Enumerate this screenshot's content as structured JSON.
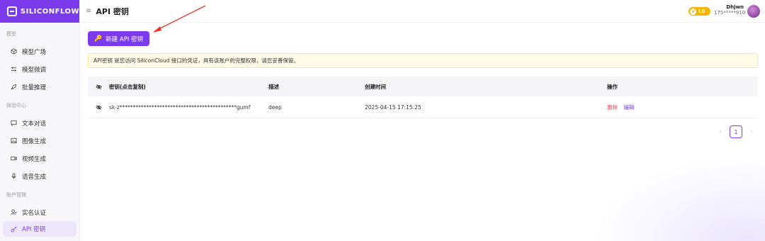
{
  "brand": {
    "name": "SILICONFLOW"
  },
  "sidebar": {
    "sections": [
      {
        "title": "模型",
        "items": [
          {
            "label": "模型广场",
            "icon": "cube-icon"
          },
          {
            "label": "模型微调",
            "icon": "sliders-icon"
          },
          {
            "label": "批量推理",
            "icon": "rocket-icon"
          }
        ]
      },
      {
        "title": "体验中心",
        "items": [
          {
            "label": "文本对话",
            "icon": "chat-icon"
          },
          {
            "label": "图像生成",
            "icon": "image-icon"
          },
          {
            "label": "视频生成",
            "icon": "video-icon"
          },
          {
            "label": "语音生成",
            "icon": "mic-icon"
          }
        ]
      },
      {
        "title": "账户管理",
        "items": [
          {
            "label": "实名认证",
            "icon": "user-check-icon"
          },
          {
            "label": "API 密钥",
            "icon": "key-icon",
            "active": true
          }
        ]
      }
    ]
  },
  "header": {
    "title": "API 密钥",
    "level": "L0",
    "level_icon_text": "V",
    "user_name": "Dhjwn",
    "user_phone": "175*****910"
  },
  "actions": {
    "create_label": "新建 API 密钥"
  },
  "notice": "API密钥 是您访问 SiliconCloud 接口的凭证，具有该账户的完整权限，请您妥善保管。",
  "table": {
    "columns": [
      "密钥(点击复制)",
      "描述",
      "创建时间",
      "操作"
    ],
    "rows": [
      {
        "key": "sk-z********************************************gumf",
        "description": "deep",
        "created": "2025-04-15 17:15:25",
        "delete": "删除",
        "edit": "编辑"
      }
    ]
  },
  "pagination": {
    "current": "1",
    "prev": "‹",
    "next": "›"
  },
  "colors": {
    "accent": "#7c3aed",
    "danger": "#e5484d",
    "badge": "#f4b400",
    "notice_bg": "#fffbe6"
  }
}
